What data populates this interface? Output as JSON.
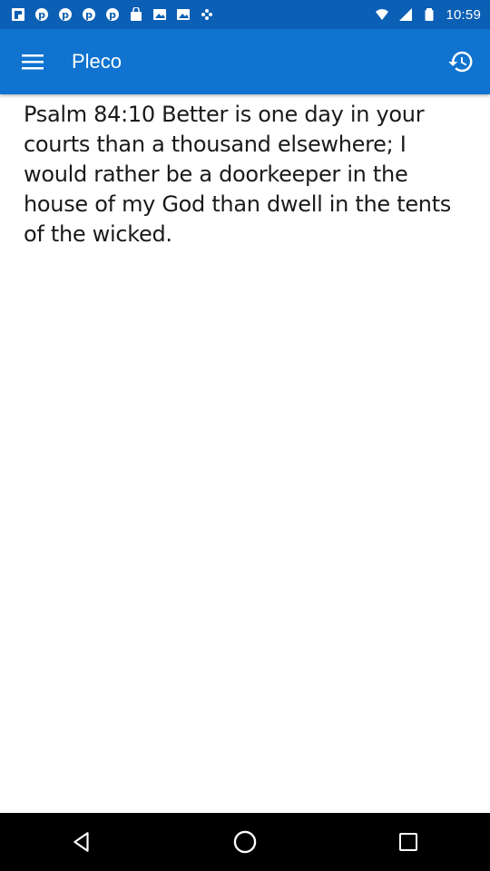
{
  "status_bar": {
    "time": "10:59",
    "notification_icons": [
      "flipboard-icon",
      "pinterest-icon",
      "pinterest-icon",
      "pinterest-icon",
      "pinterest-icon",
      "bag-icon",
      "photo-icon",
      "photo-icon",
      "dots-icon"
    ],
    "system_icons": [
      "wifi-icon",
      "signal-icon",
      "battery-icon"
    ]
  },
  "app_bar": {
    "title": "Pleco",
    "left_icon": "menu-icon",
    "right_icon": "history-icon",
    "color": "#0f73cf"
  },
  "content": {
    "verse": "Psalm 84:10 Better is one day in your courts than a thousand elsewhere; I would rather be a doorkeeper in the house of my God than dwell in the tents of the wicked."
  },
  "nav_bar": {
    "buttons": [
      "back-icon",
      "home-icon",
      "recents-icon"
    ]
  }
}
